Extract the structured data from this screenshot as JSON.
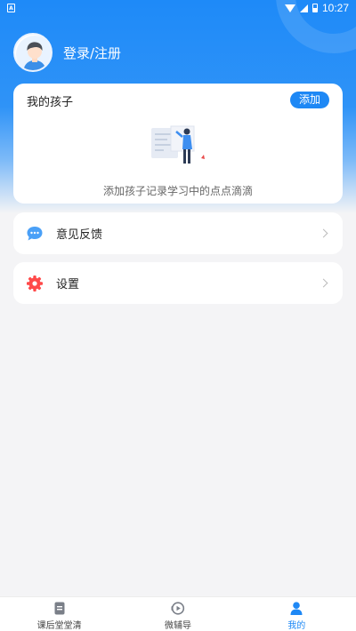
{
  "status_bar": {
    "time": "10:27",
    "icons": [
      "app-notification-icon",
      "wifi-icon",
      "signal-icon",
      "battery-icon"
    ]
  },
  "profile": {
    "login_label": "登录/注册",
    "avatar_icon": "user-avatar-icon"
  },
  "kids_card": {
    "title": "我的孩子",
    "add_button": "添加",
    "empty_text": "添加孩子记录学习中的点点滴滴",
    "illustration": "empty-state-illustration"
  },
  "menu": [
    {
      "label": "意见反馈",
      "icon": "chat-bubble-icon"
    },
    {
      "label": "设置",
      "icon": "gear-icon"
    }
  ],
  "tabbar": {
    "tabs": [
      {
        "label": "课后堂堂清",
        "icon": "book-icon",
        "active": false
      },
      {
        "label": "微辅导",
        "icon": "play-circle-icon",
        "active": false
      },
      {
        "label": "我的",
        "icon": "person-icon",
        "active": true
      }
    ]
  },
  "colors": {
    "primary": "#1e88f5",
    "background": "#f4f4f6",
    "settings_icon": "#ff4a4a"
  }
}
